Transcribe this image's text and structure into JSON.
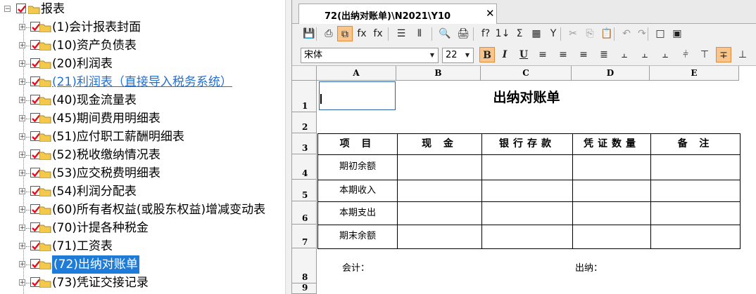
{
  "tree": {
    "root_label": "报表",
    "items": [
      {
        "label": "(1)会计报表封面"
      },
      {
        "label": "(10)资产负债表"
      },
      {
        "label": "(20)利润表"
      },
      {
        "label": "(21)利润表（直接导入税务系统）"
      },
      {
        "label": "(40)现金流量表"
      },
      {
        "label": "(45)期间费用明细表"
      },
      {
        "label": "(51)应付职工薪酬明细表"
      },
      {
        "label": "(52)税收缴纳情况表"
      },
      {
        "label": "(53)应交税费明细表"
      },
      {
        "label": "(54)利润分配表"
      },
      {
        "label": "(60)所有者权益(或股东权益)增减变动表"
      },
      {
        "label": "(70)计提各种税金"
      },
      {
        "label": "(71)工资表"
      },
      {
        "label": "(72)出纳对账单"
      },
      {
        "label": "(73)凭证交接记录"
      }
    ],
    "selected_index": 13,
    "link_index": 3
  },
  "tab": {
    "title": "72(出纳对账单)\\N2021\\Y10",
    "close": "✕"
  },
  "toolbar1": {
    "icons": [
      "save-icon",
      "print-preview-icon",
      "copy-format-icon",
      "formula-icon",
      "function-icon",
      "row-icon",
      "column-icon",
      "find-icon",
      "print-icon",
      "insert-function-icon",
      "sort-icon",
      "sum-icon",
      "calculator-icon",
      "filter-icon",
      "cut-icon",
      "copy-icon",
      "paste-icon",
      "undo-icon",
      "redo-icon",
      "border-box-icon",
      "border-outer-icon"
    ],
    "glyphs": [
      "💾",
      "⎙",
      "⧉",
      "fx",
      "fx",
      "☰",
      "⫴",
      "🔍",
      "🖨",
      "f?",
      "1↓",
      "Σ",
      "▦",
      "Y",
      "✂",
      "⎘",
      "📋",
      "↶",
      "↷",
      "□",
      "▣"
    ]
  },
  "toolbar2": {
    "font_name": "宋体",
    "font_size": "22",
    "bold": "B",
    "italic": "I",
    "underline": "U"
  },
  "sheet": {
    "columns": [
      "A",
      "B",
      "C",
      "D",
      "E"
    ],
    "rows": [
      "1",
      "2",
      "3",
      "4",
      "5",
      "6",
      "7",
      "8",
      "9"
    ],
    "title": "出纳对账单",
    "headers": [
      "项 目",
      "现 金",
      "银行存款",
      "凭证数量",
      "备 注"
    ],
    "row_labels": [
      "期初余额",
      "本期收入",
      "本期支出",
      "期末余额"
    ],
    "footer_left": "会计：",
    "footer_right": "出纳："
  }
}
